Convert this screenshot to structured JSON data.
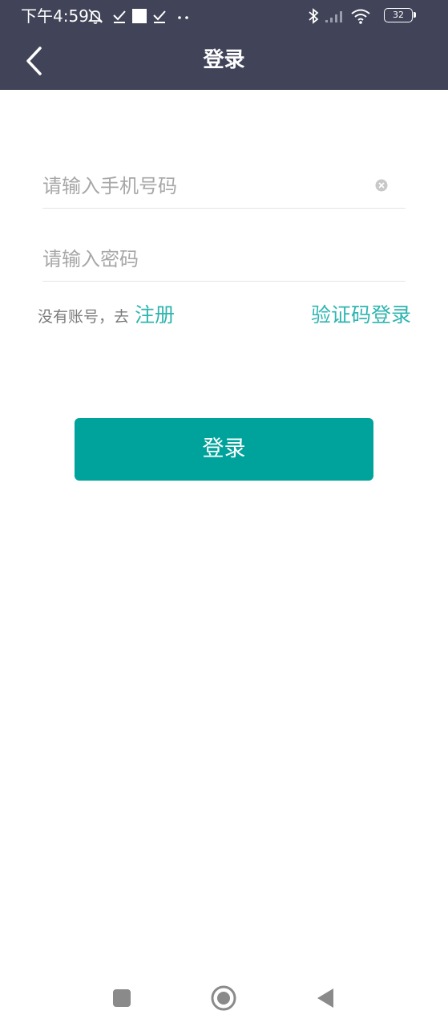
{
  "status_bar": {
    "time": "下午4:59",
    "battery": "32"
  },
  "header": {
    "title": "登录"
  },
  "form": {
    "phone_placeholder": "请输入手机号码",
    "phone_value": "",
    "password_placeholder": "请输入密码",
    "password_value": ""
  },
  "links": {
    "register_prompt": "没有账号，去",
    "register_label": "注册",
    "sms_login_label": "验证码登录"
  },
  "login_button": {
    "label": "登录"
  },
  "colors": {
    "header_bg": "#414458",
    "accent_link": "#2db5b0",
    "primary_button": "#00a39b"
  },
  "icons": {
    "back": "chevron-left-icon",
    "clear": "clear-x-icon",
    "nav_recents": "square-icon",
    "nav_home": "circle-icon",
    "nav_back": "triangle-back-icon"
  }
}
